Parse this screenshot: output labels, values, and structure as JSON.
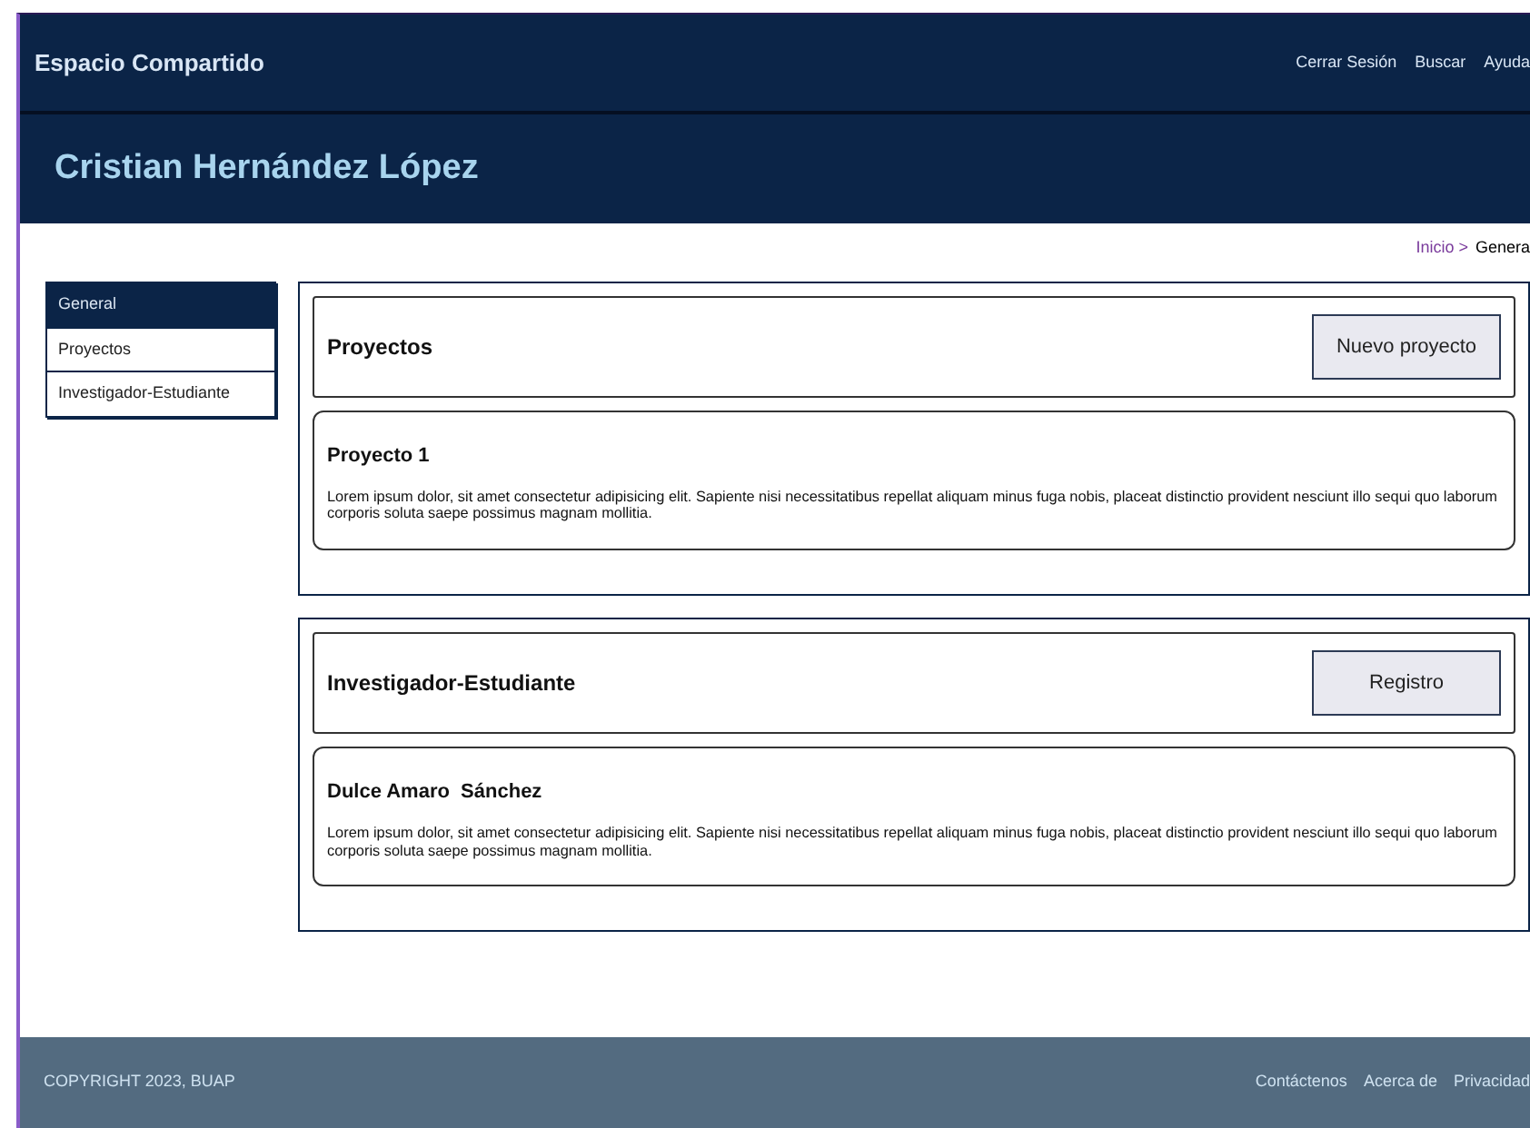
{
  "topbar": {
    "brand": "Espacio Compartido",
    "links": [
      "Cerrar Sesión",
      "Buscar",
      "Ayuda"
    ]
  },
  "user_name": "Cristian Hernández López",
  "breadcrumb": [
    {
      "label": "Inicio >",
      "kind": "link"
    },
    {
      "label": "Genera",
      "kind": "current"
    }
  ],
  "sidebar": {
    "items": [
      {
        "label": "General",
        "selected": true
      },
      {
        "label": "Proyectos",
        "selected": false
      },
      {
        "label": "Investigador-Estudiante",
        "selected": false
      }
    ]
  },
  "sections": [
    {
      "title": "Proyectos",
      "button": "Nuevo proyecto",
      "cards": [
        {
          "title": "Proyecto 1",
          "text": "Lorem ipsum dolor, sit amet consectetur adipisicing elit. Sapiente nisi necessitatibus repellat aliquam minus fuga nobis, placeat distinctio provident nesciunt illo sequi quo laborum corporis soluta saepe possimus magnam mollitia."
        }
      ]
    },
    {
      "title": "Investigador-Estudiante",
      "button": "Registro",
      "cards": [
        {
          "title": "Dulce Amaro  Sánchez",
          "text": "Lorem ipsum dolor, sit amet consectetur adipisicing elit. Sapiente nisi necessitatibus repellat aliquam minus fuga nobis, placeat distinctio provident nesciunt illo sequi quo laborum corporis soluta saepe possimus magnam mollitia."
        }
      ]
    }
  ],
  "footer": {
    "copyright": "COPYRIGHT 2023, BUAP",
    "links": [
      "Contáctenos",
      "Acerca de",
      "Privacidad"
    ]
  }
}
